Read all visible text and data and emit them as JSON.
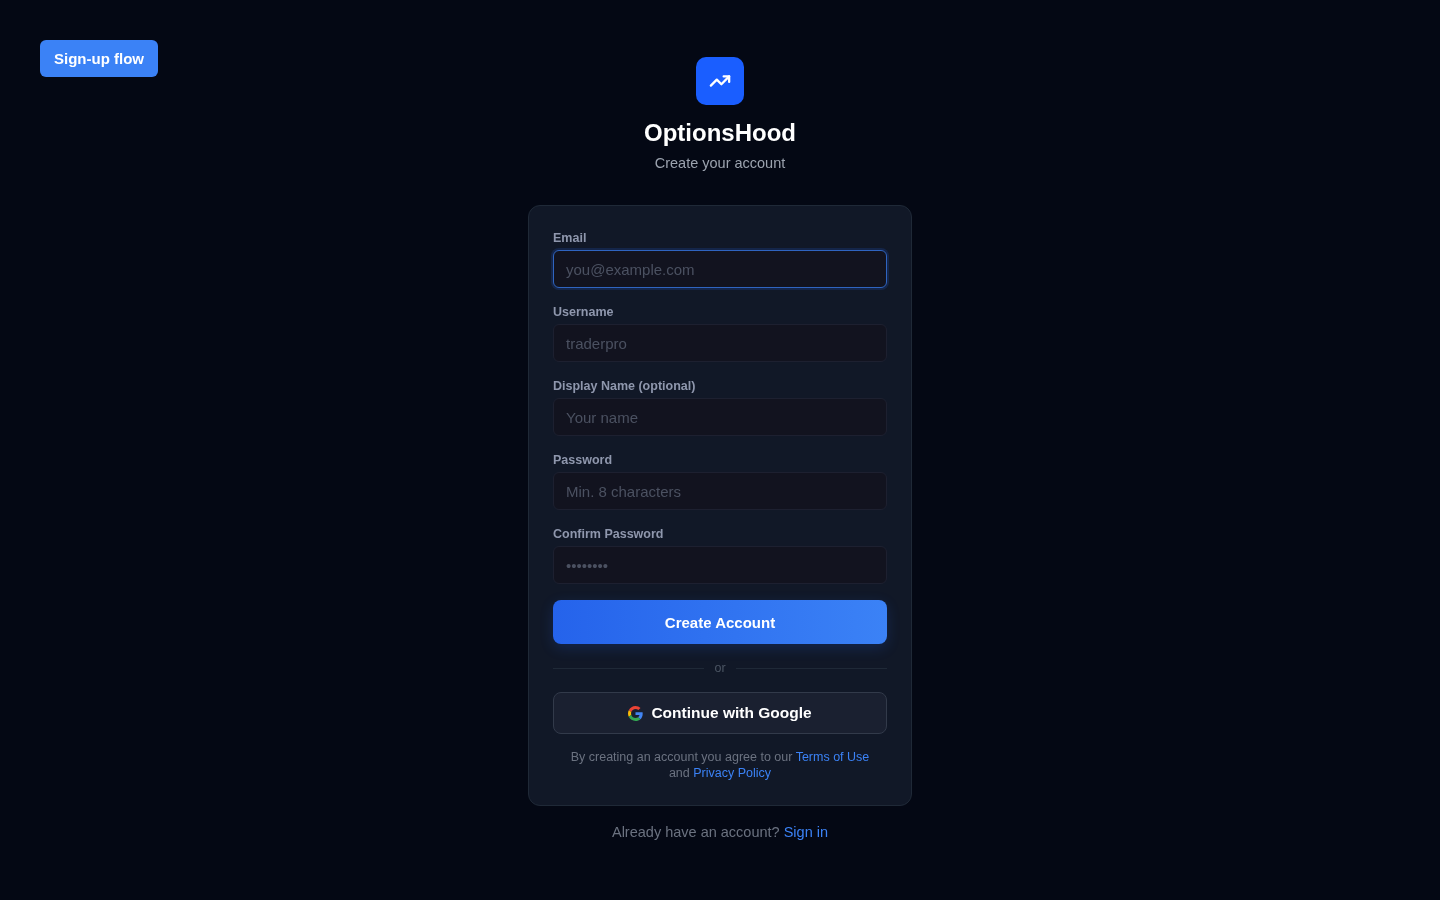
{
  "dev_button": {
    "label": "Sign-up flow"
  },
  "brand": {
    "name": "OptionsHood",
    "subtitle": "Create your account"
  },
  "form": {
    "fields": [
      {
        "label": "Email",
        "placeholder": "you@example.com",
        "focused": true
      },
      {
        "label": "Username",
        "placeholder": "traderpro",
        "focused": false
      },
      {
        "label": "Display Name (optional)",
        "placeholder": "Your name",
        "focused": false
      },
      {
        "label": "Password",
        "placeholder": "Min. 8 characters",
        "focused": false
      },
      {
        "label": "Confirm Password",
        "placeholder": "••••••••",
        "focused": false
      }
    ],
    "submit": "Create Account",
    "divider": "or",
    "google_button": "Continue with Google",
    "legal": {
      "text": "By creating an account you agree to our",
      "terms_link": "Terms of Use",
      "joiner": "and",
      "privacy_link": "Privacy Policy"
    }
  },
  "footer": {
    "text": "Already have an account?",
    "link": "Sign in"
  }
}
